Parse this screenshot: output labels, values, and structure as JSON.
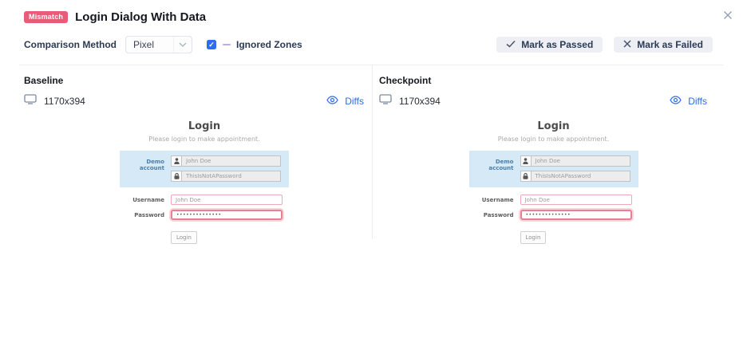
{
  "header": {
    "badge": "Mismatch",
    "title": "Login Dialog With Data"
  },
  "toolbar": {
    "comparison_method_label": "Comparison Method",
    "comparison_method_value": "Pixel",
    "ignored_zones_checked": true,
    "ignored_zones_label": "Ignored Zones",
    "mark_as_passed_label": "Mark as Passed",
    "mark_as_failed_label": "Mark as Failed"
  },
  "panels": [
    {
      "title": "Baseline",
      "resolution": "1170x394",
      "diffs_label": "Diffs"
    },
    {
      "title": "Checkpoint",
      "resolution": "1170x394",
      "diffs_label": "Diffs"
    }
  ],
  "screenshot": {
    "heading": "Login",
    "subheading": "Please login to make appointment.",
    "demo_label": "Demo account",
    "demo_username": "John Doe",
    "demo_password": "ThisIsNotAPassword",
    "username_label": "Username",
    "username_value": "John Doe",
    "password_label": "Password",
    "password_value": "••••••••••••••",
    "login_button_label": "Login"
  },
  "icons": {
    "close": "✕",
    "checkbox_check": "✓",
    "monitor": "monitor-icon",
    "eye": "eye-icon",
    "check": "check-icon",
    "cross": "x-icon",
    "person": "person-icon",
    "lock": "lock-icon",
    "chevron_down": "chevron-down-icon"
  },
  "colors": {
    "badge_bg": "#e85c77",
    "checkbox_blue": "#2e6cf0",
    "link_blue": "#2e6ae5",
    "ignored_zone_legend": "#bda9e8",
    "diff_highlight_border": "#e97f93",
    "demo_box_bg": "#d6e9f6",
    "button_bg": "#edeff4"
  }
}
